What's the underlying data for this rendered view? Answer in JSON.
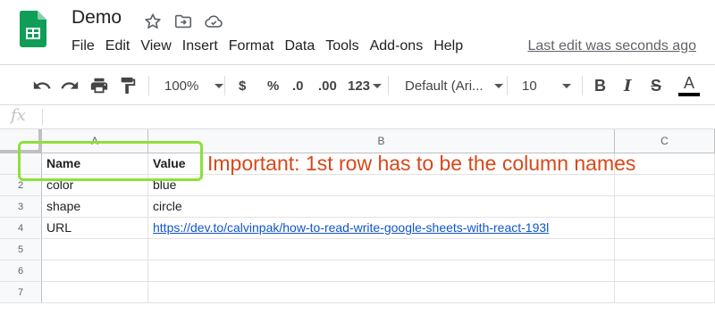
{
  "app": {
    "doc_title": "Demo",
    "last_edit": "Last edit was seconds ago",
    "brand_color": "#0f9d58"
  },
  "menu": [
    "File",
    "Edit",
    "View",
    "Insert",
    "Format",
    "Data",
    "Tools",
    "Add-ons",
    "Help"
  ],
  "toolbar": {
    "zoom": "100%",
    "currency": "$",
    "percent": "%",
    "decrease_decimal": ".0",
    "increase_decimal": ".00",
    "more_formats": "123",
    "font": "Default (Ari...",
    "font_size": "10",
    "bold": "B",
    "italic": "I",
    "strikethrough": "S",
    "text_color": "A"
  },
  "formula_bar": {
    "fx": "fx",
    "value": ""
  },
  "sheet": {
    "columns": [
      "A",
      "B",
      "C"
    ],
    "rows": [
      {
        "num": "",
        "a": "Name",
        "b": "Value",
        "c": ""
      },
      {
        "num": "2",
        "a": "color",
        "b": "blue",
        "c": ""
      },
      {
        "num": "3",
        "a": "shape",
        "b": "circle",
        "c": ""
      },
      {
        "num": "4",
        "a": "URL",
        "b": "https://dev.to/calvinpak/how-to-read-write-google-sheets-with-react-193l",
        "c": ""
      },
      {
        "num": "5",
        "a": "",
        "b": "",
        "c": ""
      },
      {
        "num": "6",
        "a": "",
        "b": "",
        "c": ""
      },
      {
        "num": "7",
        "a": "",
        "b": "",
        "c": ""
      }
    ]
  },
  "annotation": {
    "text": "Important: 1st row has to be the column names",
    "text_color": "#d9481a",
    "box_color": "#8ee03a"
  }
}
